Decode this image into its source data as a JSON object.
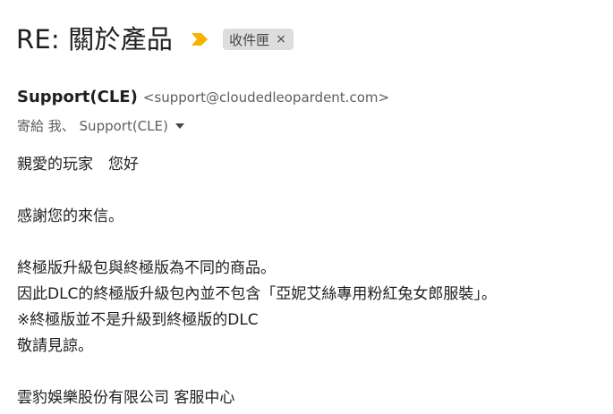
{
  "email": {
    "subject": "RE: 關於產品",
    "label": "收件匣",
    "label_remove": "×",
    "sender": {
      "name": "Support(CLE)",
      "email": "<support@cloudedleopardent.com>"
    },
    "recipients": "寄給 我、 Support(CLE)",
    "body_lines": [
      "親愛的玩家　您好",
      "",
      "感謝您的來信。",
      "",
      "終極版升級包與終極版為不同的商品。",
      "因此DLC的終極版升級包內並不包含「亞妮艾絲專用粉紅兔女郎服裝」。",
      "※終極版並不是升級到終極版的DLC",
      "敬請見諒。",
      "",
      "雲豹娛樂股份有限公司 客服中心"
    ]
  },
  "colors": {
    "importance_marker": "#f4b400",
    "label_chip_bg": "#dddddd"
  },
  "icons": {
    "importance": "importance-marker-icon",
    "recipients_toggle": "caret-down-icon"
  }
}
